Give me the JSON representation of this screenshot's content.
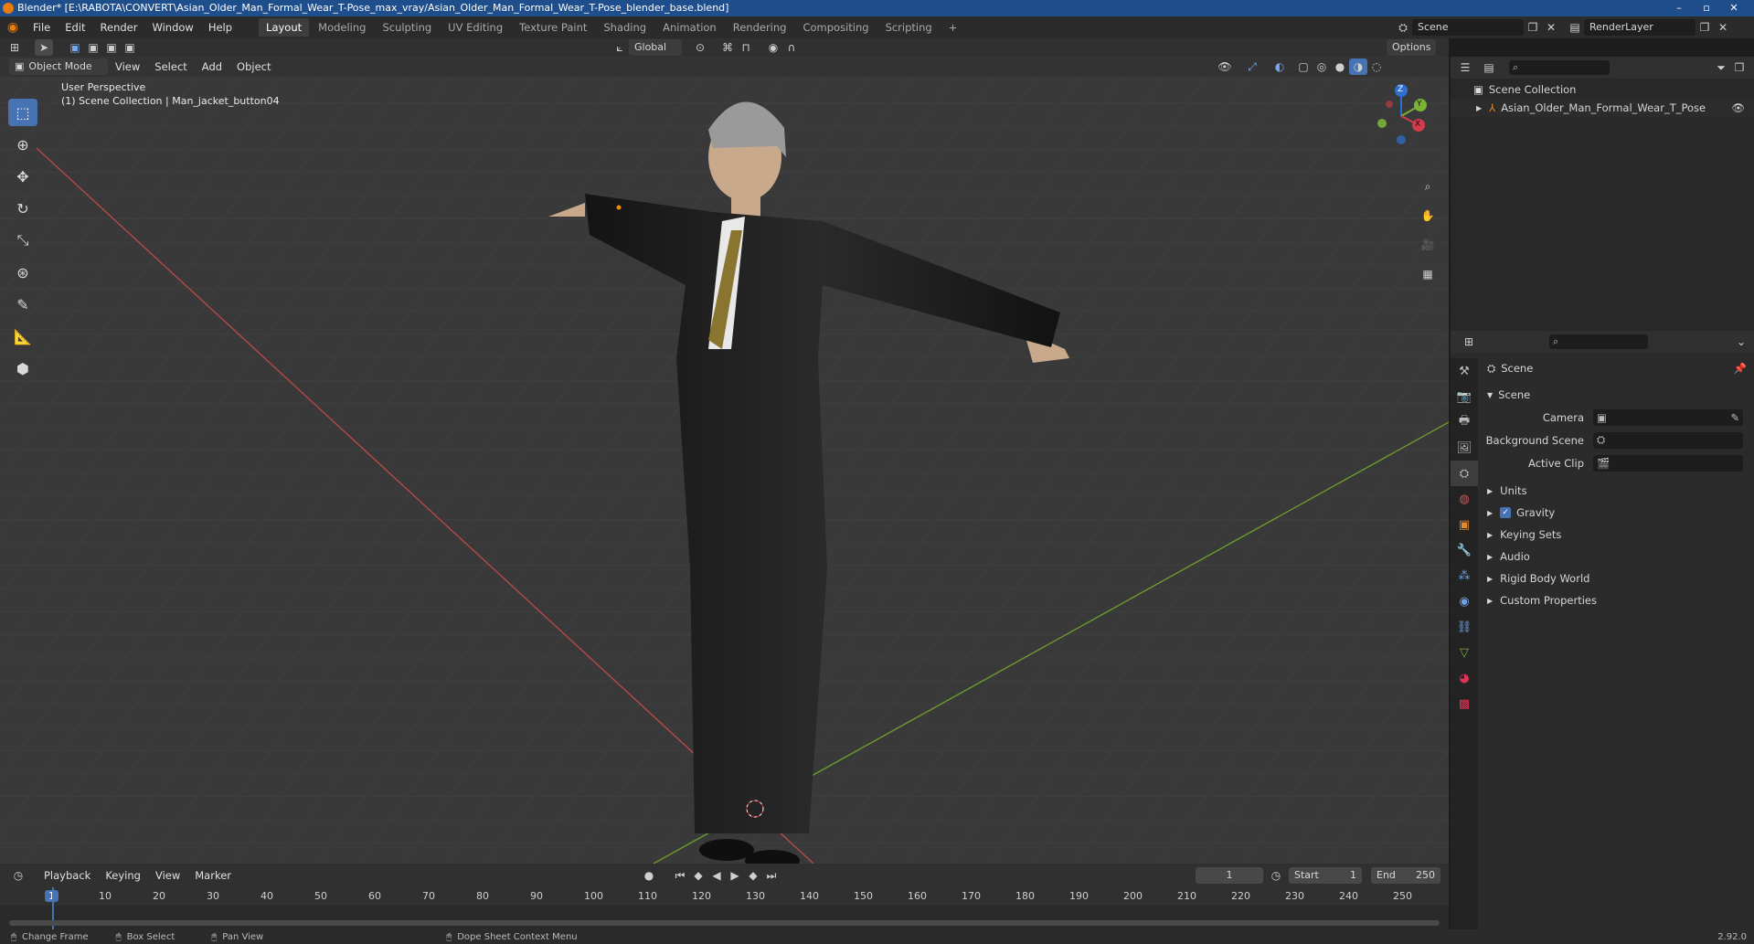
{
  "window": {
    "title": "Blender* [E:\\RABOTA\\CONVERT\\Asian_Older_Man_Formal_Wear_T-Pose_max_vray/Asian_Older_Man_Formal_Wear_T-Pose_blender_base.blend]"
  },
  "menubar": {
    "menus": [
      "File",
      "Edit",
      "Render",
      "Window",
      "Help"
    ],
    "workspaces": [
      "Layout",
      "Modeling",
      "Sculpting",
      "UV Editing",
      "Texture Paint",
      "Shading",
      "Animation",
      "Rendering",
      "Compositing",
      "Scripting"
    ],
    "add_tab": "+",
    "scene": "Scene",
    "view_layer": "RenderLayer"
  },
  "tool_header": {
    "orientation": "Global",
    "options": "Options"
  },
  "viewport_header": {
    "mode": "Object Mode",
    "menus": [
      "View",
      "Select",
      "Add",
      "Object"
    ]
  },
  "viewport": {
    "view_name": "User Perspective",
    "context": "(1) Scene Collection | Man_jacket_button04",
    "gizmo": {
      "x": "X",
      "y": "Y",
      "z": "Z"
    }
  },
  "outliner": {
    "root": "Scene Collection",
    "item": "Asian_Older_Man_Formal_Wear_T_Pose"
  },
  "properties": {
    "breadcrumb": "Scene",
    "panel": "Scene",
    "camera_label": "Camera",
    "bg_scene_label": "Background Scene",
    "active_clip_label": "Active Clip",
    "subpanels": [
      "Units",
      "Gravity",
      "Keying Sets",
      "Audio",
      "Rigid Body World",
      "Custom Properties"
    ]
  },
  "timeline": {
    "menus": [
      "Playback",
      "Keying",
      "View",
      "Marker"
    ],
    "current_frame": "1",
    "start_label": "Start",
    "start": "1",
    "end_label": "End",
    "end": "250",
    "ruler": [
      "1",
      "10",
      "20",
      "30",
      "40",
      "50",
      "60",
      "70",
      "80",
      "90",
      "100",
      "110",
      "120",
      "130",
      "140",
      "150",
      "160",
      "170",
      "180",
      "190",
      "200",
      "210",
      "220",
      "230",
      "240",
      "250"
    ]
  },
  "statusbar": {
    "items": [
      "Change Frame",
      "Box Select",
      "Pan View",
      "Dope Sheet Context Menu"
    ],
    "version": "2.92.0"
  }
}
